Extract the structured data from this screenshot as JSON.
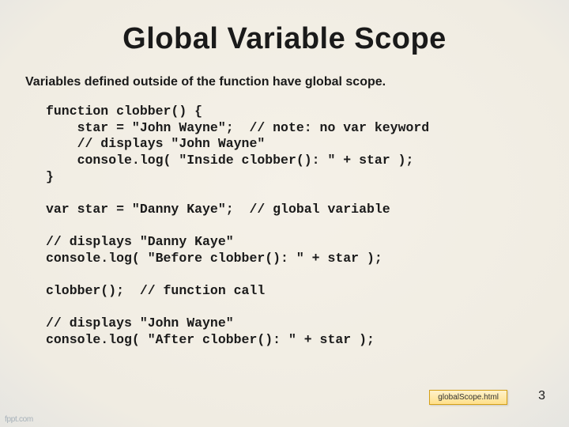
{
  "title": "Global Variable Scope",
  "subtitle": "Variables defined outside of the function have global scope.",
  "code": "function clobber() {\n    star = \"John Wayne\";  // note: no var keyword\n    // displays \"John Wayne\"\n    console.log( \"Inside clobber(): \" + star );\n}\n\nvar star = \"Danny Kaye\";  // global variable\n\n// displays \"Danny Kaye\"\nconsole.log( \"Before clobber(): \" + star );\n\nclobber();  // function call\n\n// displays \"John Wayne\"\nconsole.log( \"After clobber(): \" + star );",
  "badge": "globalScope.html",
  "page_number": "3",
  "logo": "fppt.com"
}
